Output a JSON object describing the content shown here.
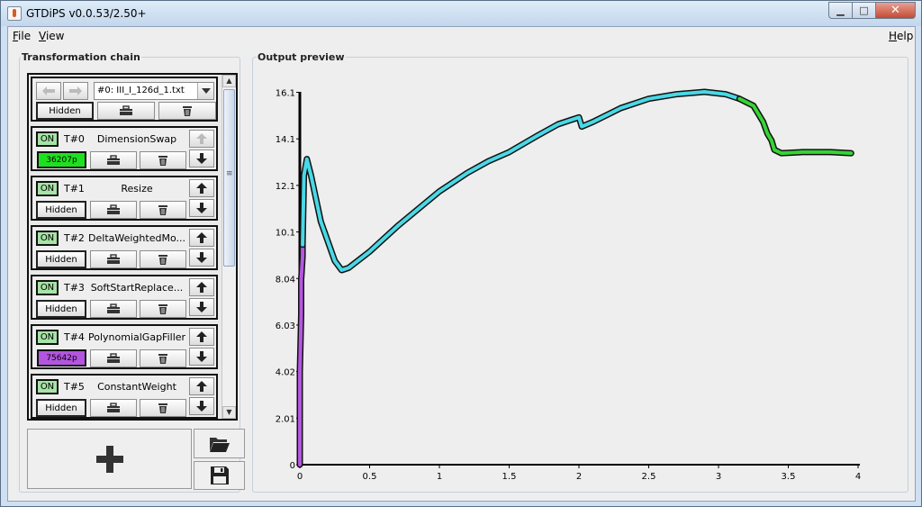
{
  "window": {
    "title": "GTDiPS v0.0.53/2.50+",
    "min_glyph": "▁",
    "max_glyph": "□",
    "close_glyph": "✕"
  },
  "menu": {
    "file": "File",
    "view": "View",
    "help": "Help"
  },
  "chain": {
    "title": "Transformation chain",
    "source": {
      "file": "#0: III_I_126d_1.txt",
      "hidden_label": "Hidden"
    },
    "items": [
      {
        "on": "ON",
        "num": "T#0",
        "name": "DimensionSwap",
        "badge": "36207p",
        "badge_color": "#1fe01f"
      },
      {
        "on": "ON",
        "num": "T#1",
        "name": "Resize",
        "hidden": "Hidden"
      },
      {
        "on": "ON",
        "num": "T#2",
        "name": "DeltaWeightedMo...",
        "hidden": "Hidden"
      },
      {
        "on": "ON",
        "num": "T#3",
        "name": "SoftStartReplace...",
        "hidden": "Hidden"
      },
      {
        "on": "ON",
        "num": "T#4",
        "name": "PolynomialGapFiller",
        "badge": "75642p",
        "badge_color": "#b455e0"
      },
      {
        "on": "ON",
        "num": "T#5",
        "name": "ConstantWeight",
        "hidden": "Hidden"
      }
    ]
  },
  "preview": {
    "title": "Output preview"
  },
  "colors": {
    "cyan_series": "#4ad8e6",
    "green_series": "#35d435",
    "purple_series": "#b457e0"
  },
  "chart_data": {
    "type": "line",
    "xlim": [
      0,
      4
    ],
    "ylim": [
      0,
      16.1
    ],
    "x_ticks": [
      "0",
      "0.5",
      "1",
      "1.5",
      "2",
      "2.5",
      "3",
      "3.5",
      "4"
    ],
    "x_tick_values": [
      0,
      0.5,
      1,
      1.5,
      2,
      2.5,
      3,
      3.5,
      4
    ],
    "y_ticks": [
      "0",
      "2.01",
      "4.02",
      "6.03",
      "8.04",
      "10.1",
      "12.1",
      "14.1",
      "16.1"
    ],
    "y_tick_values": [
      0,
      2.01,
      4.02,
      6.03,
      8.04,
      10.05,
      12.06,
      14.07,
      16.08
    ],
    "grid": false,
    "series": [
      {
        "color": "#b457e0",
        "x": [
          0,
          0,
          0.01,
          0.01,
          0.02,
          0.02
        ],
        "y": [
          0,
          4.0,
          6.5,
          8.0,
          9.0,
          9.5
        ]
      },
      {
        "color": "#4ad8e6",
        "x": [
          0.02,
          0.03,
          0.05,
          0.08,
          0.15,
          0.25,
          0.3,
          0.35,
          0.5,
          0.7,
          1.0,
          1.2,
          1.35,
          1.5,
          1.7,
          1.85,
          2.0,
          2.02,
          2.1,
          2.3,
          2.5,
          2.7,
          2.9,
          3.05,
          3.15
        ],
        "y": [
          9.5,
          12.5,
          13.2,
          12.5,
          10.5,
          8.8,
          8.4,
          8.5,
          9.2,
          10.3,
          11.8,
          12.6,
          13.1,
          13.5,
          14.2,
          14.7,
          15.0,
          14.6,
          14.8,
          15.4,
          15.8,
          16.0,
          16.1,
          16.0,
          15.8
        ]
      },
      {
        "color": "#35d435",
        "x": [
          3.15,
          3.25,
          3.32,
          3.35,
          3.38,
          3.4,
          3.45,
          3.6,
          3.8,
          3.95
        ],
        "y": [
          15.8,
          15.5,
          14.8,
          14.3,
          14.0,
          13.6,
          13.45,
          13.5,
          13.5,
          13.45
        ]
      }
    ]
  }
}
